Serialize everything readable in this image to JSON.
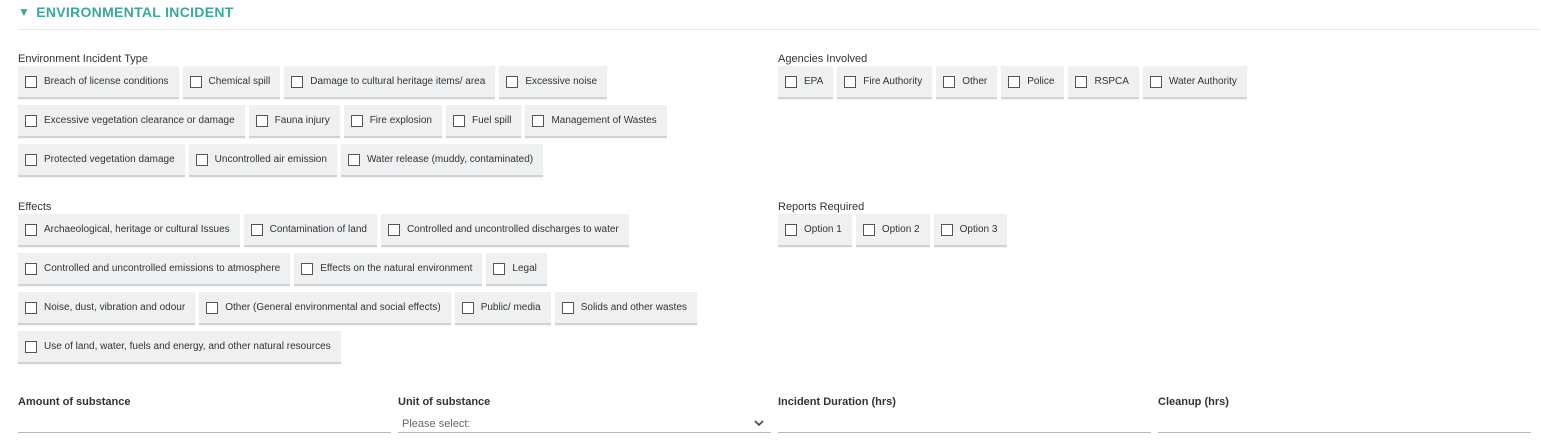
{
  "section": {
    "title": "ENVIRONMENTAL INCIDENT",
    "caret": "▼"
  },
  "incident_type": {
    "label": "Environment Incident Type",
    "rows": [
      [
        "Breach of license conditions",
        "Chemical spill",
        "Damage to cultural heritage items/ area",
        "Excessive noise"
      ],
      [
        "Excessive vegetation clearance or damage",
        "Fauna injury",
        "Fire explosion",
        "Fuel spill",
        "Management of Wastes"
      ],
      [
        "Protected vegetation damage",
        "Uncontrolled air emission",
        "Water release (muddy, contaminated)"
      ]
    ]
  },
  "agencies": {
    "label": "Agencies Involved",
    "rows": [
      [
        "EPA",
        "Fire Authority",
        "Other",
        "Police",
        "RSPCA",
        "Water Authority"
      ]
    ]
  },
  "effects": {
    "label": "Effects",
    "rows": [
      [
        "Archaeological, heritage or cultural Issues",
        "Contamination of land",
        "Controlled and uncontrolled discharges to water"
      ],
      [
        "Controlled and uncontrolled emissions to atmosphere",
        "Effects on the natural environment",
        "Legal"
      ],
      [
        "Noise, dust, vibration and odour",
        "Other (General environmental and social effects)",
        "Public/ media",
        "Solids and other wastes"
      ],
      [
        "Use of land, water, fuels and energy, and other natural resources"
      ]
    ]
  },
  "reports": {
    "label": "Reports Required",
    "rows": [
      [
        "Option 1",
        "Option 2",
        "Option 3"
      ]
    ]
  },
  "fields": {
    "amount": {
      "label": "Amount of substance",
      "value": ""
    },
    "unit": {
      "label": "Unit of substance",
      "placeholder": "Please select:"
    },
    "duration": {
      "label": "Incident Duration (hrs)",
      "value": ""
    },
    "cleanup": {
      "label": "Cleanup (hrs)",
      "value": ""
    }
  },
  "colors": {
    "accent": "#3aa89a",
    "chip_bg": "#eef0f2"
  },
  "icons": {
    "collapse": "caret-down-icon",
    "select": "chevron-down-icon"
  }
}
